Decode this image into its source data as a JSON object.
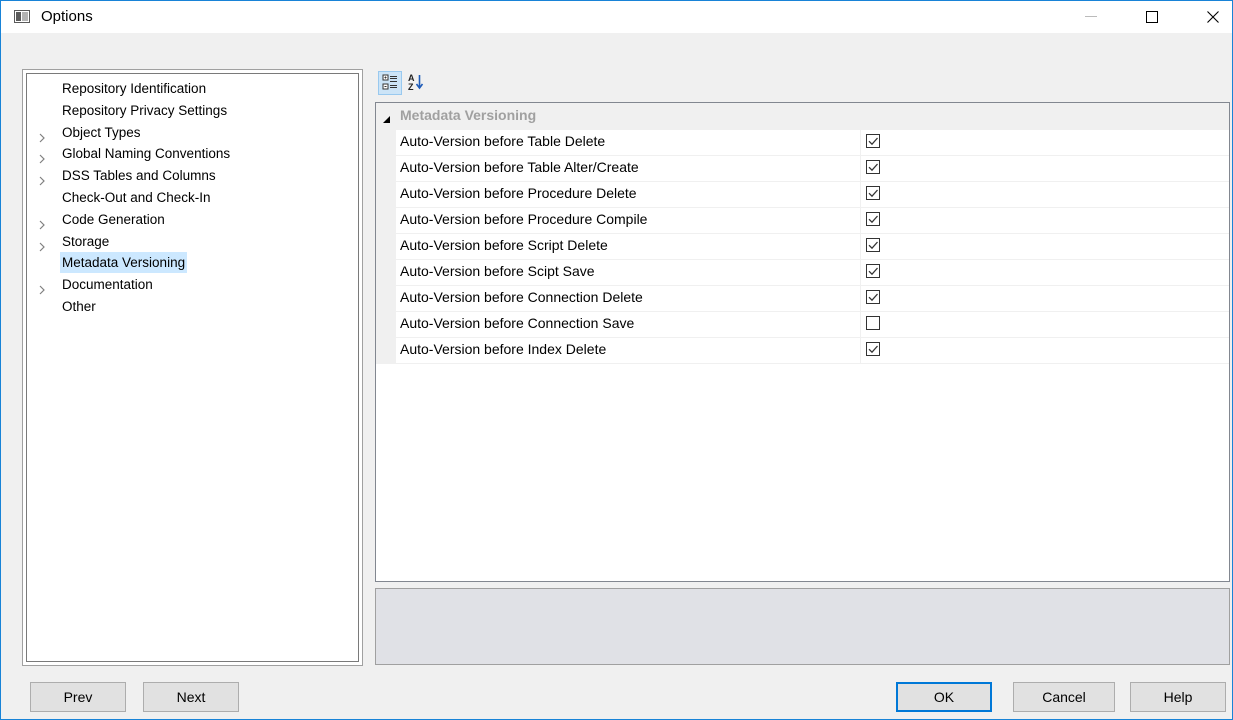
{
  "window": {
    "title": "Options",
    "accent": "#1883d7"
  },
  "titlebar_buttons": [
    "minimize-icon",
    "maximize-icon",
    "close-icon"
  ],
  "tree": {
    "items": [
      {
        "label": "Repository Identification",
        "expandable": false
      },
      {
        "label": "Repository Privacy Settings",
        "expandable": false
      },
      {
        "label": "Object Types",
        "expandable": true
      },
      {
        "label": "Global Naming Conventions",
        "expandable": true
      },
      {
        "label": "DSS Tables and Columns",
        "expandable": true
      },
      {
        "label": "Check-Out and Check-In",
        "expandable": false
      },
      {
        "label": "Code Generation",
        "expandable": true
      },
      {
        "label": "Storage",
        "expandable": true
      },
      {
        "label": "Metadata Versioning",
        "expandable": false,
        "selected": true
      },
      {
        "label": "Documentation",
        "expandable": true
      },
      {
        "label": "Other",
        "expandable": false
      }
    ]
  },
  "toolbar": {
    "categorized_icon": "categorized-icon",
    "alphabetical_icon": "sort-alphabetical-icon"
  },
  "grid": {
    "category": "Metadata Versioning",
    "properties": [
      {
        "name": "Auto-Version before Table Delete",
        "checked": true
      },
      {
        "name": "Auto-Version before Table Alter/Create",
        "checked": true
      },
      {
        "name": "Auto-Version before Procedure Delete",
        "checked": true
      },
      {
        "name": "Auto-Version before Procedure Compile",
        "checked": true
      },
      {
        "name": "Auto-Version before Script Delete",
        "checked": true
      },
      {
        "name": "Auto-Version before Scipt Save",
        "checked": true
      },
      {
        "name": "Auto-Version before Connection Delete",
        "checked": true
      },
      {
        "name": "Auto-Version before Connection Save",
        "checked": false
      },
      {
        "name": "Auto-Version before Index Delete",
        "checked": true
      }
    ]
  },
  "buttons": {
    "prev": "Prev",
    "next": "Next",
    "ok": "OK",
    "cancel": "Cancel",
    "help": "Help"
  }
}
